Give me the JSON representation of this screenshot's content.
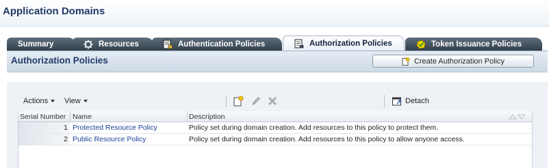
{
  "header": {
    "title": "Application Domains"
  },
  "tabs": [
    {
      "label": "Summary",
      "icon": "none",
      "active": false
    },
    {
      "label": "Resources",
      "icon": "gear-icon",
      "active": false
    },
    {
      "label": "Authentication Policies",
      "icon": "authn-policy-icon",
      "active": false
    },
    {
      "label": "Authorization Policies",
      "icon": "authz-policy-icon",
      "active": true
    },
    {
      "label": "Token Issuance Policies",
      "icon": "token-icon",
      "active": false
    }
  ],
  "panel": {
    "title": "Authorization Policies",
    "create_button": "Create Authorization Policy"
  },
  "toolbar": {
    "actions": "Actions",
    "view": "View",
    "detach": "Detach"
  },
  "table": {
    "columns": [
      "Serial Number",
      "Name",
      "Description"
    ],
    "rows": [
      {
        "serial": "1",
        "name": "Protected Resource Policy",
        "description": "Policy set during domain creation. Add resources to this policy to protect them."
      },
      {
        "serial": "2",
        "name": "Public Resource Policy",
        "description": "Policy set during domain creation. Add resources to this policy to allow anyone access."
      }
    ]
  },
  "colors": {
    "title": "#213a66",
    "link": "#1c3f94",
    "tab_dark": "#3b4753"
  }
}
